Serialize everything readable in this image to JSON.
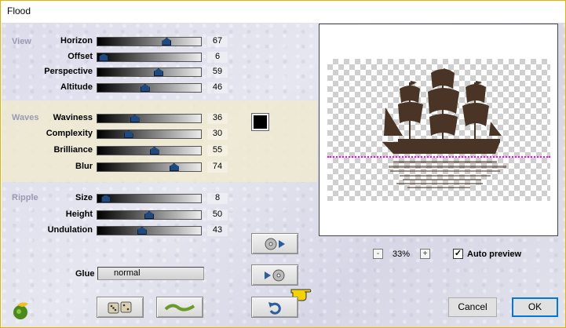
{
  "window": {
    "title": "Flood"
  },
  "sections": {
    "view": "View",
    "waves": "Waves",
    "ripple": "Ripple"
  },
  "sliders": [
    {
      "id": "horizon",
      "label": "Horizon",
      "value": "67",
      "level": 0.67
    },
    {
      "id": "offset",
      "label": "Offset",
      "value": "6",
      "level": 0.06
    },
    {
      "id": "perspective",
      "label": "Perspective",
      "value": "59",
      "level": 0.59
    },
    {
      "id": "altitude",
      "label": "Altitude",
      "value": "46",
      "level": 0.46
    },
    {
      "id": "waviness",
      "label": "Waviness",
      "value": "36",
      "level": 0.36
    },
    {
      "id": "complexity",
      "label": "Complexity",
      "value": "30",
      "level": 0.3
    },
    {
      "id": "brilliance",
      "label": "Brilliance",
      "value": "55",
      "level": 0.55
    },
    {
      "id": "blur",
      "label": "Blur",
      "value": "74",
      "level": 0.74
    },
    {
      "id": "size",
      "label": "Size",
      "value": "8",
      "level": 0.08
    },
    {
      "id": "height",
      "label": "Height",
      "value": "50",
      "level": 0.5
    },
    {
      "id": "undulation",
      "label": "Undulation",
      "value": "43",
      "level": 0.43
    }
  ],
  "glue": {
    "label": "Glue",
    "value": "normal"
  },
  "zoom": {
    "value": "33%",
    "minus": "-",
    "plus": "+"
  },
  "auto_preview": {
    "label": "Auto preview",
    "checked": true,
    "mark": "✓"
  },
  "buttons": {
    "cancel": "Cancel",
    "ok": "OK"
  },
  "colors": {
    "wave_color": "#000000",
    "ship": "#4a3426",
    "accent": "#0078d7"
  }
}
